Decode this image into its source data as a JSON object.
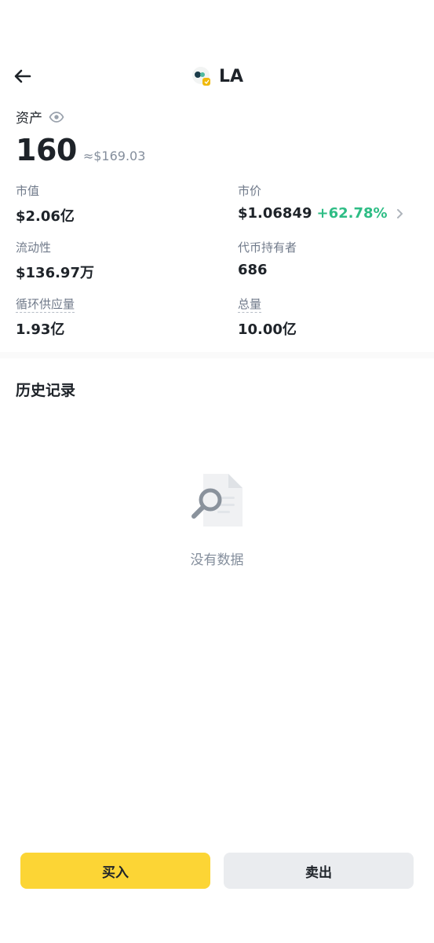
{
  "header": {
    "back_icon": "arrow-left-icon",
    "token_logo_icon": "token-logo-icon",
    "token_symbol": "LA"
  },
  "assets": {
    "label": "资产",
    "eye_icon": "eye-icon",
    "balance": "160",
    "balance_usd": "≈$169.03"
  },
  "stats": {
    "market_cap": {
      "label": "市值",
      "value": "$2.06亿"
    },
    "price": {
      "label": "市价",
      "value": "$1.06849",
      "change": "+62.78%",
      "change_color": "#2ebd85"
    },
    "liquidity": {
      "label": "流动性",
      "value": "$136.97万"
    },
    "holders": {
      "label": "代币持有者",
      "value": "686"
    },
    "circulating": {
      "label": "循环供应量",
      "value": "1.93亿"
    },
    "total": {
      "label": "总量",
      "value": "10.00亿"
    }
  },
  "history": {
    "title": "历史记录",
    "empty_icon": "search-document-icon",
    "empty_text": "没有数据"
  },
  "actions": {
    "buy_label": "买入",
    "buy_color": "#fcd535",
    "sell_label": "卖出",
    "sell_color": "#eaecef"
  }
}
